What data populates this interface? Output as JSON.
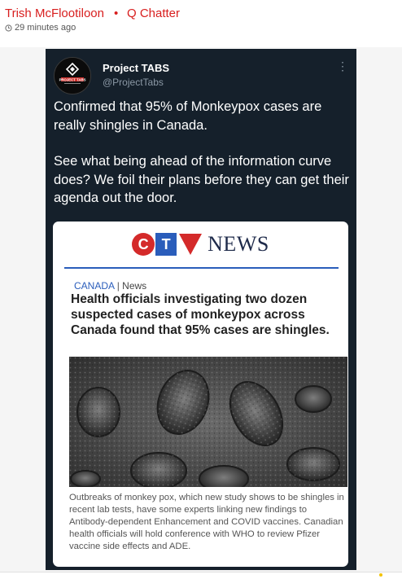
{
  "post": {
    "author": "Trish McFlootiloon",
    "separator": "•",
    "group": "Q Chatter",
    "time": "29 minutes ago"
  },
  "tweet": {
    "account_name": "Project TABS",
    "handle": "@ProjectTabs",
    "avatar_text": "PROJECT TABS",
    "paragraphs": [
      "Confirmed that 95% of Monkeypox cases are really shingles in Canada.",
      "See what being ahead of the information curve does?  We foil their plans before they can get their agenda out the door."
    ]
  },
  "card": {
    "logo_c": "C",
    "logo_t": "T",
    "logo_news": "NEWS",
    "section": "CANADA",
    "section_sep": "|",
    "section_sub": "News",
    "headline": "Health officials investigating two dozen suspected cases of monkeypox across Canada found that 95% cases are shingles.",
    "caption": "Outbreaks of monkey pox, which new study shows to be shingles in recent lab tests, have some experts linking new findings to Antibody-dependent Enhancement and COVID vaccines. Canadian health officials will hold conference with WHO to review Pfizer vaccine side effects and ADE."
  },
  "colors": {
    "author_red": "#d81e1e",
    "tweet_bg": "#15202b",
    "ctv_red": "#d42a2a",
    "ctv_blue": "#2a5dbb"
  }
}
